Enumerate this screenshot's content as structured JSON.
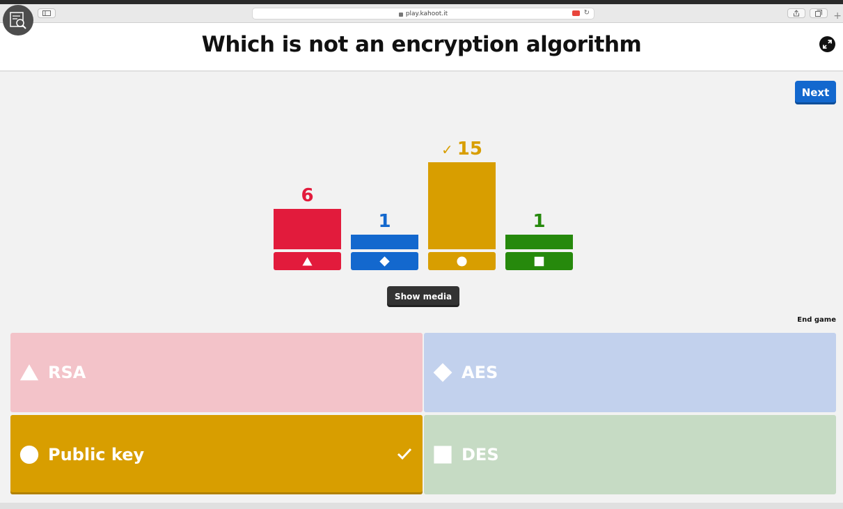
{
  "browser": {
    "url": "play.kahoot.it"
  },
  "question": {
    "title": "Which is not an encryption algorithm"
  },
  "controls": {
    "next_label": "Next",
    "show_media_label": "Show media",
    "end_game_label": "End game"
  },
  "chart_data": {
    "type": "bar",
    "categories": [
      "RSA",
      "AES",
      "Public key",
      "DES"
    ],
    "values": [
      6,
      1,
      15,
      1
    ],
    "colors": [
      "#e21b3c",
      "#1368ce",
      "#d89e00",
      "#26890c"
    ],
    "shapes": [
      "triangle",
      "diamond",
      "circle",
      "square"
    ],
    "correct_index": 2
  },
  "answers": [
    {
      "label": "RSA",
      "shape": "triangle",
      "color": "#f3c3c9",
      "correct": false
    },
    {
      "label": "AES",
      "shape": "diamond",
      "color": "#c2d1ed",
      "correct": false
    },
    {
      "label": "Public key",
      "shape": "circle",
      "color": "#d89e00",
      "correct": true
    },
    {
      "label": "DES",
      "shape": "square",
      "color": "#c6dbc4",
      "correct": false
    }
  ]
}
